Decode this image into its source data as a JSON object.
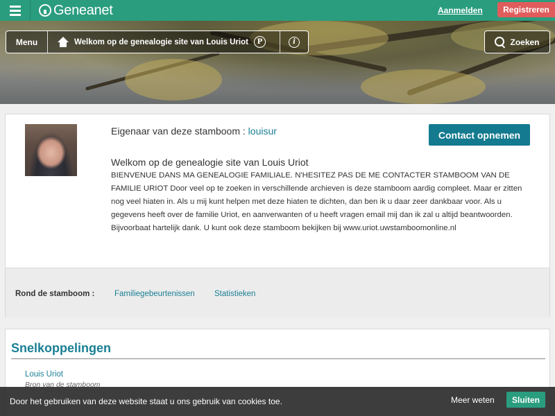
{
  "header": {
    "logo_text": "Geneanet",
    "login_label": "Aanmelden",
    "register_label": "Registreren",
    "brand_color": "#2a9d7f"
  },
  "nav": {
    "menu_label": "Menu",
    "title": "Welkom op de genealogie site van Louis Uriot",
    "p_badge": "P",
    "info_glyph": "i",
    "search_label": "Zoeken"
  },
  "owner": {
    "prefix": "Eigenaar van deze stamboom : ",
    "username": "louisur",
    "contact_label": "Contact opnemen",
    "welcome_title": "Welkom op de genealogie site van Louis Uriot",
    "welcome_text": "BIENVENUE DANS MA GENEALOGIE FAMILIALE. N'HESITEZ PAS DE ME CONTACTER STAMBOOM VAN DE FAMILIE URIOT Door veel op te zoeken in verschillende archieven is deze stamboom aardig compleet. Maar er zitten nog veel hiaten in. Als u mij kunt helpen met deze hiaten te dichten, dan ben ik u daar zeer dankbaar voor. Als u gegevens heeft over de familie Uriot, en aanverwanten of u heeft vragen email mij dan ik zal u altijd beantwoorden. Bijvoorbaat hartelijk dank. U kunt ook deze stamboom bekijken bij www.uriot.uwstamboomonline.nl"
  },
  "around": {
    "label": "Rond de stamboom :",
    "links": [
      "Familiegebeurtenissen",
      "Statistieken"
    ]
  },
  "shortcuts": {
    "title": "Snelkoppelingen",
    "items": [
      {
        "name": "Louis Uriot",
        "subtitle": "Bron van de stamboom"
      }
    ]
  },
  "cookie": {
    "text": "Door het gebruiken van deze website staat u ons gebruik van cookies toe.",
    "more_label": "Meer weten",
    "close_label": "Sluiten"
  }
}
